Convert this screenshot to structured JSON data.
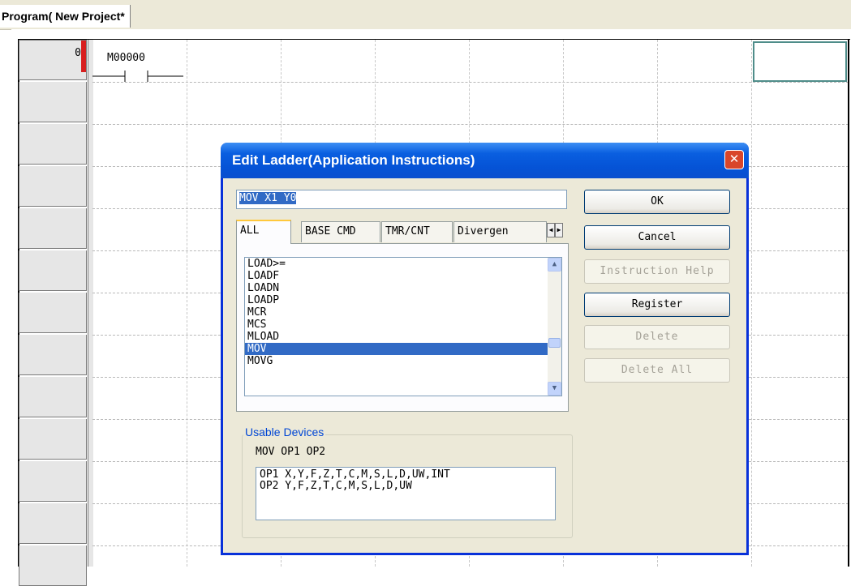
{
  "tab": {
    "title": "Program( New Project*"
  },
  "ladder": {
    "row_numbers": [
      "0",
      "",
      "",
      "",
      "",
      "",
      "",
      "",
      "",
      "",
      "",
      "",
      ""
    ],
    "contact_label": "M00000"
  },
  "dialog": {
    "title": "Edit Ladder(Application Instructions)",
    "close_icon": "close-icon",
    "instruction_value": "MOV X1 Y0",
    "buttons": {
      "ok": "OK",
      "cancel": "Cancel",
      "instruction_help": "Instruction Help",
      "register": "Register",
      "delete": "Delete",
      "delete_all": "Delete All"
    },
    "tabs": [
      "ALL",
      "BASE CMD",
      "TMR/CNT",
      "Divergen"
    ],
    "list_items": [
      "LOAD>=",
      "LOADF",
      "LOADN",
      "LOADP",
      "MCR",
      "MCS",
      "MLOAD",
      "MOV",
      "MOVG"
    ],
    "selected_item": "MOV",
    "usable_devices": {
      "legend": "Usable Devices",
      "usage": "MOV OP1 OP2",
      "lines": [
        "OP1 X,Y,F,Z,T,C,M,S,L,D,UW,INT",
        "OP2 Y,F,Z,T,C,M,S,L,D,UW"
      ]
    }
  },
  "colors": {
    "title_bar": "#0553d6",
    "selection": "#316ac5",
    "active_marker": "#d81e1e",
    "cursor_cell": "#4f8d8a"
  }
}
